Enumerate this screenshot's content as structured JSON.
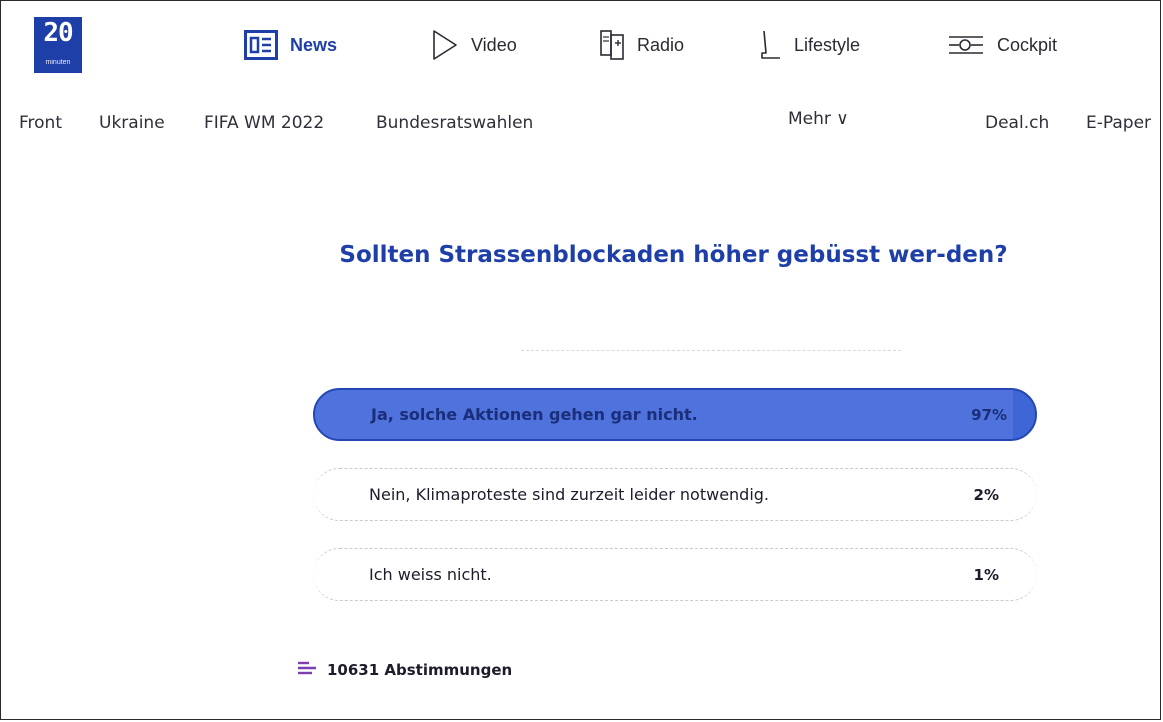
{
  "logo": {
    "number": "20",
    "subtitle": "minuten"
  },
  "nav": {
    "items": [
      {
        "label": "News",
        "icon": "news-icon"
      },
      {
        "label": "Video",
        "icon": "play-icon"
      },
      {
        "label": "Radio",
        "icon": "radio-icon"
      },
      {
        "label": "Lifestyle",
        "icon": "lifestyle-icon"
      },
      {
        "label": "Cockpit",
        "icon": "cockpit-icon"
      }
    ],
    "active": "News"
  },
  "subnav": {
    "links": [
      "Front",
      "Ukraine",
      "FIFA WM 2022",
      "Bundesratswahlen"
    ],
    "more": "Mehr ∨",
    "right_links": [
      "Deal.ch",
      "E-Paper"
    ]
  },
  "poll": {
    "question": "Sollten Strassenblockaden höher gebüsst wer-den?",
    "options": [
      {
        "label": "Ja, solche Aktionen gehen gar nicht.",
        "percent": "97%",
        "share": 0.97,
        "selected": true
      },
      {
        "label": "Nein, Klimaproteste sind zurzeit leider notwendig.",
        "percent": "2%",
        "share": 0.02,
        "selected": false
      },
      {
        "label": "Ich weiss nicht.",
        "percent": "1%",
        "share": 0.01,
        "selected": false
      }
    ],
    "votes": "10631 Abstimmungen"
  },
  "colors": {
    "brand": "#1f3fa8",
    "bar": "#4f72dc"
  }
}
